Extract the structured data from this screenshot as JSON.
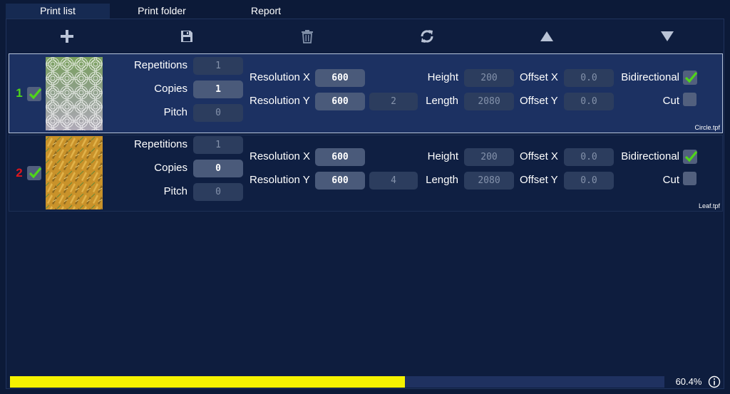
{
  "tabs": [
    {
      "label": "Print list",
      "active": true
    },
    {
      "label": "Print folder",
      "active": false
    },
    {
      "label": "Report",
      "active": false
    }
  ],
  "toolbar": {
    "icons": [
      "plus-icon",
      "save-icon",
      "trash-icon",
      "refresh-icon",
      "arrow-up-icon",
      "arrow-down-icon"
    ]
  },
  "labels": {
    "repetitions": "Repetitions",
    "copies": "Copies",
    "pitch": "Pitch",
    "resolution_x": "Resolution X",
    "resolution_y": "Resolution Y",
    "height": "Height",
    "length": "Length",
    "offset_x": "Offset X",
    "offset_y": "Offset Y",
    "bidirectional": "Bidirectional",
    "cut": "Cut"
  },
  "jobs": [
    {
      "index": "1",
      "index_color": "#4fd51a",
      "enabled": true,
      "thumbnail": "concentric-circle-pattern",
      "repetitions": "1",
      "copies": "1",
      "pitch": "0",
      "resolution_x": "600",
      "resolution_y": "600",
      "passes": "2",
      "height": "200",
      "length": "2080",
      "offset_x": "0.0",
      "offset_y": "0.0",
      "bidirectional": true,
      "cut": false,
      "filename": "Circle.tpf"
    },
    {
      "index": "2",
      "index_color": "#e0161c",
      "enabled": true,
      "thumbnail": "leaf-pattern",
      "repetitions": "1",
      "copies": "0",
      "pitch": "0",
      "resolution_x": "600",
      "resolution_y": "600",
      "passes": "4",
      "height": "200",
      "length": "2080",
      "offset_x": "0.0",
      "offset_y": "0.0",
      "bidirectional": true,
      "cut": false,
      "filename": "Leaf.tpf"
    }
  ],
  "progress": {
    "fraction": 0.604,
    "label": "60.4%"
  },
  "colors": {
    "background": "#0c1a38",
    "selected_row": "#1c3162",
    "check_green": "#4fd51a",
    "progress_fill": "#f5f200"
  }
}
